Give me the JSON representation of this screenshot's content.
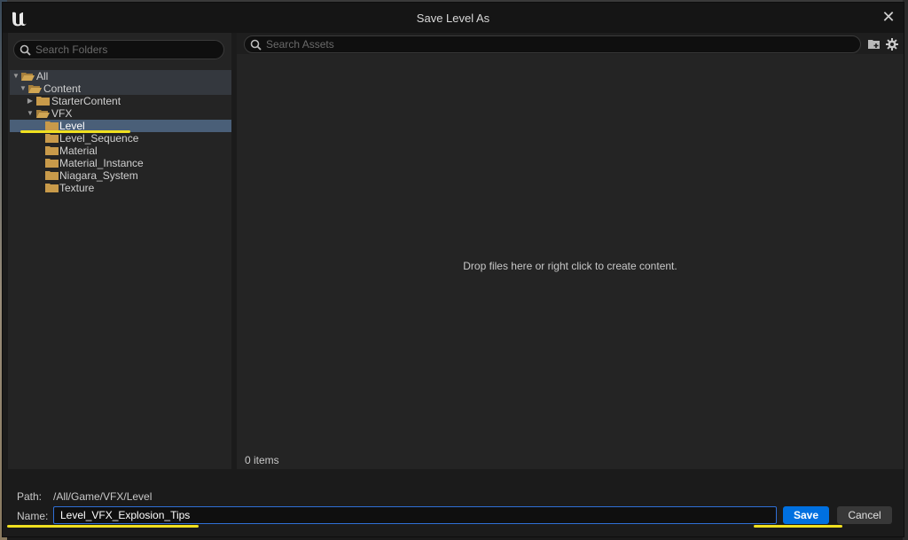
{
  "dialog": {
    "title": "Save Level As"
  },
  "folders": {
    "search_placeholder": "Search Folders",
    "tree": [
      {
        "label": "All"
      },
      {
        "label": "Content"
      },
      {
        "label": "StarterContent"
      },
      {
        "label": "VFX"
      },
      {
        "label": "Level"
      },
      {
        "label": "Level_Sequence"
      },
      {
        "label": "Material"
      },
      {
        "label": "Material_Instance"
      },
      {
        "label": "Niagara_System"
      },
      {
        "label": "Texture"
      }
    ]
  },
  "assets": {
    "search_placeholder": "Search Assets",
    "empty_message": "Drop files here or right click to create content.",
    "item_count": "0 items"
  },
  "footer": {
    "path_label": "Path:",
    "path_value": "/All/Game/VFX/Level",
    "name_label": "Name:",
    "name_value": "Level_VFX_Explosion_Tips",
    "save_label": "Save",
    "cancel_label": "Cancel"
  },
  "colors": {
    "accent": "#0070e0",
    "folder": "#c89a4a",
    "selection": "#4a5f78",
    "highlight_marker": "#f0e020"
  },
  "icons": {
    "app_logo": "unreal-logo-icon",
    "close": "close-icon",
    "search": "search-icon",
    "folder": "folder-icon",
    "new_folder": "folder-add-icon",
    "settings": "gear-icon"
  }
}
